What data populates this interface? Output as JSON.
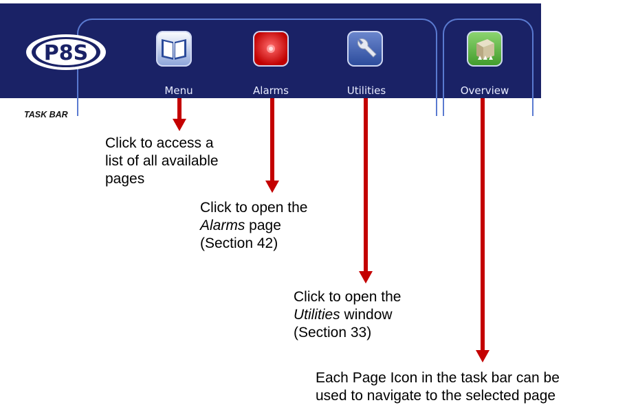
{
  "taskbar": {
    "caption": "TASK BAR",
    "logo_text": "P8S",
    "buttons": [
      {
        "label": "Menu",
        "icon": "book-icon"
      },
      {
        "label": "Alarms",
        "icon": "alarm-icon"
      },
      {
        "label": "Utilities",
        "icon": "wrench-icon"
      },
      {
        "label": "Overview",
        "icon": "cube-icon"
      }
    ]
  },
  "notes": {
    "menu": {
      "l1": "Click to access a",
      "l2": "list of all available",
      "l3": "pages"
    },
    "alarms": {
      "l1": "Click to open the",
      "l2_em": "Alarms",
      "l2_rest": " page",
      "l3": "(Section 42)"
    },
    "utilities": {
      "l1": "Click to open the",
      "l2_em": "Utilities",
      "l2_rest": " window",
      "l3": "(Section 33)"
    },
    "overview": {
      "l1": "Each Page Icon in the task bar can be",
      "l2": "used to navigate to the selected page"
    }
  },
  "colors": {
    "taskbar_bg": "#1a2266",
    "arrow": "#c40000",
    "accent": "#5a7ad0"
  }
}
